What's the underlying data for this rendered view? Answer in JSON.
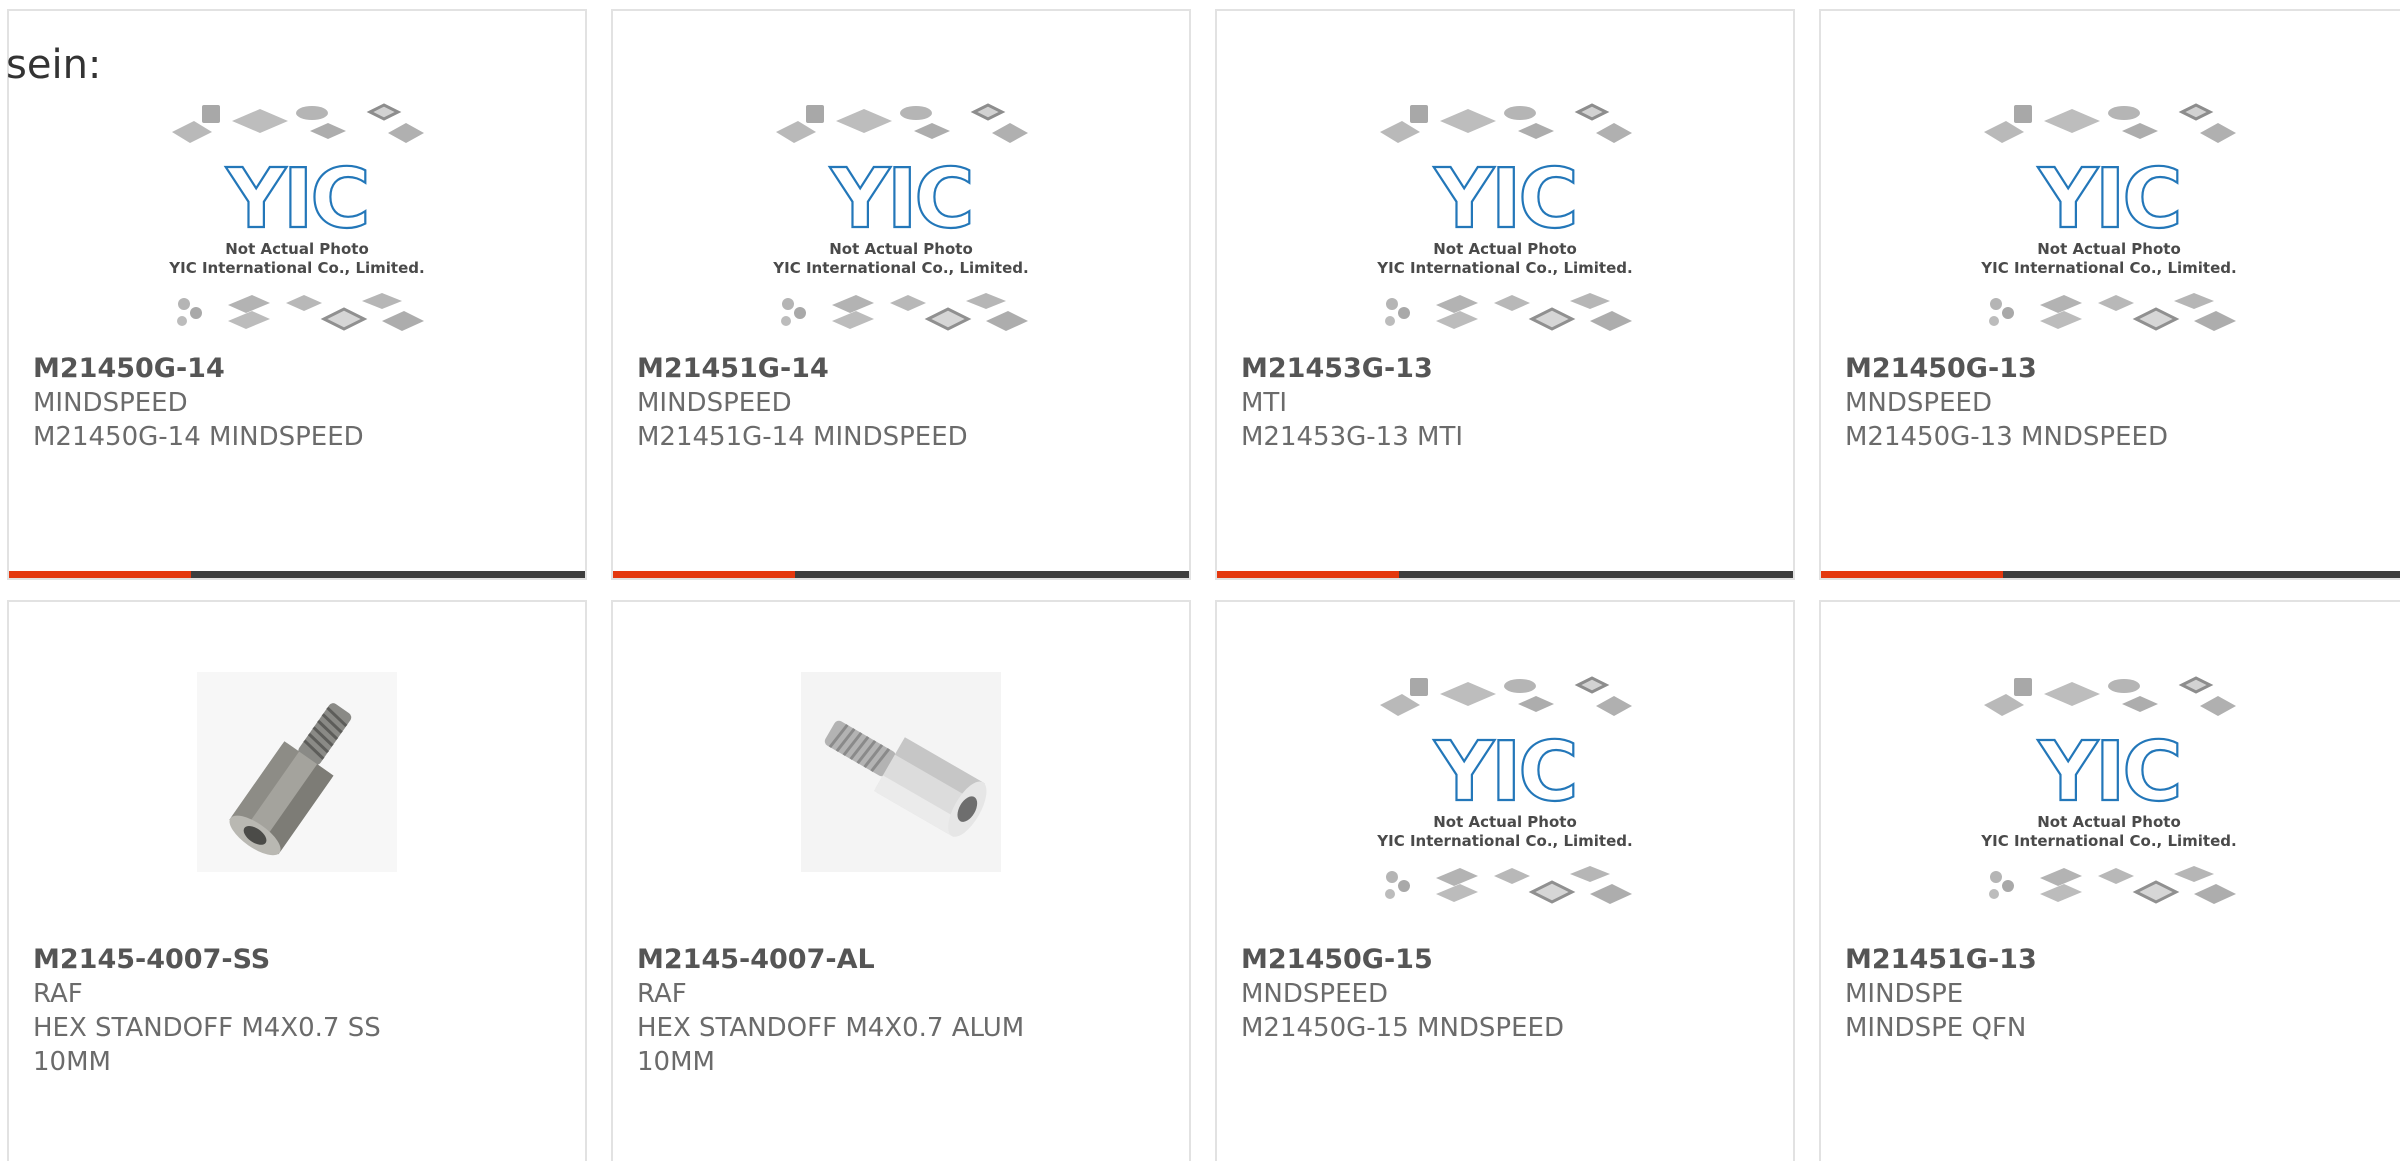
{
  "heading": "sein:",
  "placeholder_image": {
    "logo_text": "YIC",
    "line1": "Not Actual Photo",
    "line2": "YIC International Co., Limited."
  },
  "colors": {
    "accent": "#e4380f",
    "bar_dark": "#3d3d3d",
    "logo_blue": "#2377b9",
    "card_border": "#e2e2e2",
    "text_gray": "#6b6b6b"
  },
  "products": [
    {
      "part": "M21450G-14",
      "manufacturer": "MINDSPEED",
      "description": "M21450G-14 MINDSPEED",
      "image": "placeholder"
    },
    {
      "part": "M21451G-14",
      "manufacturer": "MINDSPEED",
      "description": "M21451G-14 MINDSPEED",
      "image": "placeholder"
    },
    {
      "part": "M21453G-13",
      "manufacturer": "MTI",
      "description": "M21453G-13 MTI",
      "image": "placeholder"
    },
    {
      "part": "M21450G-13",
      "manufacturer": "MNDSPEED",
      "description": "M21450G-13 MNDSPEED",
      "image": "placeholder"
    },
    {
      "part": "M2145-4007-SS",
      "manufacturer": "RAF",
      "description": "HEX STANDOFF M4X0.7 SS 10MM",
      "image": "hex-standoff-steel"
    },
    {
      "part": "M2145-4007-AL",
      "manufacturer": "RAF",
      "description": "HEX STANDOFF M4X0.7 ALUM 10MM",
      "image": "hex-standoff-aluminum"
    },
    {
      "part": "M21450G-15",
      "manufacturer": "MNDSPEED",
      "description": "M21450G-15 MNDSPEED",
      "image": "placeholder"
    },
    {
      "part": "M21451G-13",
      "manufacturer": "MINDSPE",
      "description": "MINDSPE QFN",
      "image": "placeholder"
    }
  ]
}
